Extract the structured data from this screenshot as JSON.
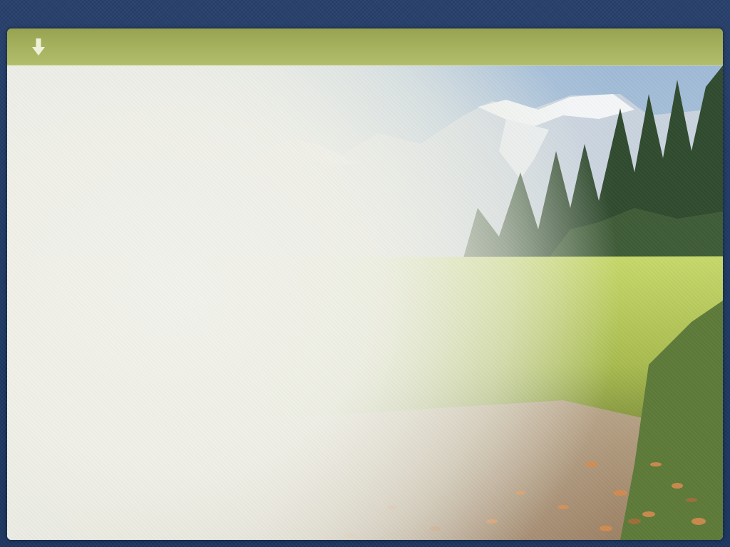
{
  "header": {
    "download_icon": "arrow-down-icon"
  },
  "colors": {
    "page_background": "#213b67",
    "header_bar": "#a4b05c",
    "icon": "#ecefd6",
    "sky": "#a9c3dd",
    "meadow": "#c9d96a",
    "foliage": "#2e4a2c",
    "leaves": "#d08a50"
  }
}
